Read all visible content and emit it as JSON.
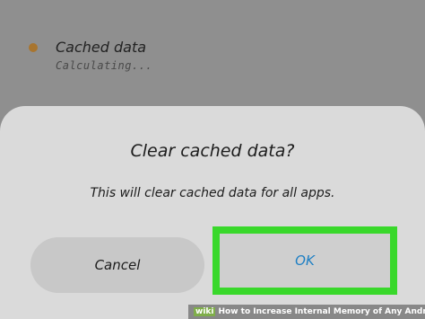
{
  "background_list": {
    "item_title": "Cached data",
    "item_subtitle": "Calculating..."
  },
  "dialog": {
    "title": "Clear cached data?",
    "message": "This will clear cached data for all apps.",
    "cancel_label": "Cancel",
    "ok_label": "OK"
  },
  "watermark": {
    "logo": "wiki",
    "text": "How to Increase Internal Memory of Any Android Phone"
  },
  "colors": {
    "highlight": "#39d82b",
    "ok_text": "#1d7fc4",
    "bullet": "#a8752f"
  }
}
